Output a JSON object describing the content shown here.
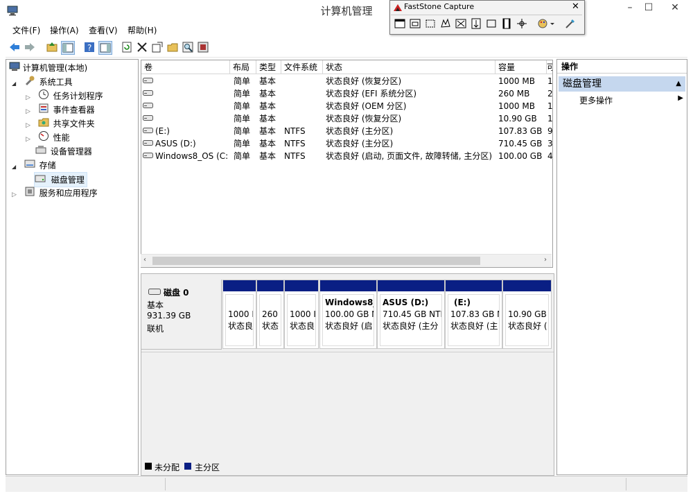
{
  "window": {
    "title": "计算机管理",
    "minimize": "–",
    "maximize": "☐",
    "close": "✕"
  },
  "capture_toolbar": {
    "title": "FastStone Capture",
    "close": "✕"
  },
  "menu": [
    "文件(F)",
    "操作(A)",
    "查看(V)",
    "帮助(H)"
  ],
  "tree": {
    "root": "计算机管理(本地)",
    "items": [
      {
        "label": "系统工具",
        "level": 1,
        "expander": "◢"
      },
      {
        "label": "任务计划程序",
        "level": 2,
        "expander": "▷"
      },
      {
        "label": "事件查看器",
        "level": 2,
        "expander": "▷"
      },
      {
        "label": "共享文件夹",
        "level": 2,
        "expander": "▷"
      },
      {
        "label": "性能",
        "level": 2,
        "expander": "▷"
      },
      {
        "label": "设备管理器",
        "level": 2,
        "expander": ""
      },
      {
        "label": "存储",
        "level": 1,
        "expander": "◢"
      },
      {
        "label": "磁盘管理",
        "level": 2,
        "expander": "",
        "selected": true
      },
      {
        "label": "服务和应用程序",
        "level": 1,
        "expander": "▷"
      }
    ]
  },
  "volumes": {
    "columns": [
      "卷",
      "布局",
      "类型",
      "文件系统",
      "状态",
      "容量",
      "可"
    ],
    "rows": [
      {
        "vol": "",
        "layout": "简单",
        "type": "基本",
        "fs": "",
        "status": "状态良好 (恢复分区)",
        "cap": "1000 MB",
        "free": "1"
      },
      {
        "vol": "",
        "layout": "简单",
        "type": "基本",
        "fs": "",
        "status": "状态良好 (EFI 系统分区)",
        "cap": "260 MB",
        "free": "2"
      },
      {
        "vol": "",
        "layout": "简单",
        "type": "基本",
        "fs": "",
        "status": "状态良好 (OEM 分区)",
        "cap": "1000 MB",
        "free": "1"
      },
      {
        "vol": "",
        "layout": "简单",
        "type": "基本",
        "fs": "",
        "status": "状态良好 (恢复分区)",
        "cap": "10.90 GB",
        "free": "1"
      },
      {
        "vol": "(E:)",
        "layout": "简单",
        "type": "基本",
        "fs": "NTFS",
        "status": "状态良好 (主分区)",
        "cap": "107.83 GB",
        "free": "9"
      },
      {
        "vol": "ASUS (D:)",
        "layout": "简单",
        "type": "基本",
        "fs": "NTFS",
        "status": "状态良好 (主分区)",
        "cap": "710.45 GB",
        "free": "3"
      },
      {
        "vol": "Windows8_OS (C:)",
        "layout": "简单",
        "type": "基本",
        "fs": "NTFS",
        "status": "状态良好 (启动, 页面文件, 故障转储, 主分区)",
        "cap": "100.00 GB",
        "free": "4"
      }
    ]
  },
  "disk": {
    "name": "磁盘 0",
    "type": "基本",
    "size": "931.39 GB",
    "state": "联机",
    "partitions": [
      {
        "title": "",
        "line1": "1000 I",
        "line2": "状态良"
      },
      {
        "title": "",
        "line1": "260",
        "line2": "状态"
      },
      {
        "title": "",
        "line1": "1000 I",
        "line2": "状态良"
      },
      {
        "title": "Windows8_",
        "line1": "100.00 GB N",
        "line2": "状态良好 (启"
      },
      {
        "title": "ASUS (D:)",
        "line1": "710.45 GB NTI",
        "line2": "状态良好 (主分"
      },
      {
        "title": "(E:)",
        "line1": "107.83 GB N",
        "line2": "状态良好 (主"
      },
      {
        "title": "",
        "line1": "10.90 GB",
        "line2": "状态良好 ("
      }
    ]
  },
  "legend": {
    "unallocated": "未分配",
    "primary": "主分区"
  },
  "actions": {
    "header": "操作",
    "section": "磁盘管理",
    "more": "更多操作"
  },
  "colors": {
    "partition_bar": "#0a1f84",
    "unallocated": "#000000",
    "selection": "#cce8ff",
    "actions_section": "#c5d7ee"
  }
}
